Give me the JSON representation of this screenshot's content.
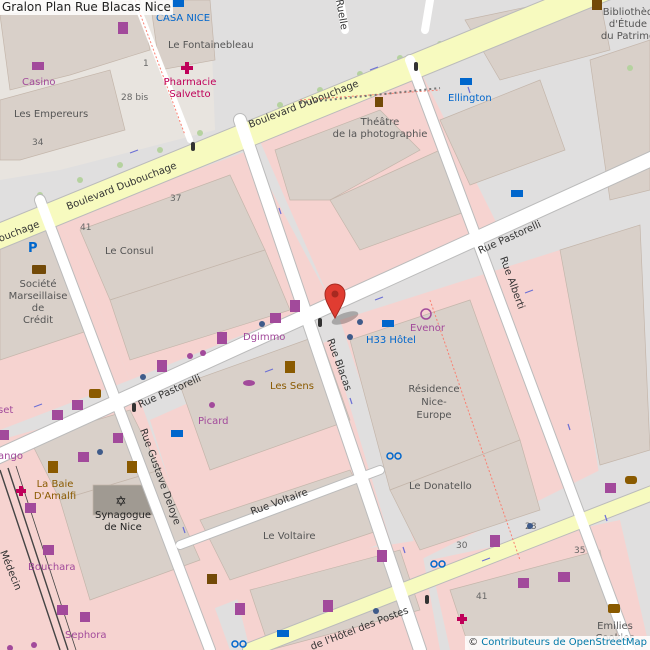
{
  "title": "Gralon Plan Rue Blacas Nice",
  "attribution": {
    "symbol": "©",
    "text": "Contributeurs de OpenStreetMap"
  },
  "colors": {
    "land": "#f2efe9",
    "residential": "#e0dfdf",
    "pedestrian": "#f6d3d0",
    "building": "#d9d0c9",
    "building_edge": "#c4b6ab",
    "primary_road": "#fcd6a4",
    "secondary_road": "#f7fabf",
    "residential_road": "#ffffff",
    "street_label": "#333333",
    "poi_label": "#a24a9b",
    "address_label": "#666666",
    "marker": "#e03c31",
    "tram": "#444444"
  },
  "streets": [
    {
      "id": "boulevard-dubouchage-upper",
      "text": "Boulevard Dubouchage"
    },
    {
      "id": "boulevard-dubouchage-lower",
      "text": "Boulevard Dubouchage"
    },
    {
      "id": "boulevard-dubouchage-edge",
      "text": "ouchage"
    },
    {
      "id": "rue-pastorelli-east",
      "text": "Rue Pastorelli"
    },
    {
      "id": "rue-pastorelli-west",
      "text": "Rue Pastorelli"
    },
    {
      "id": "rue-alberti",
      "text": "Rue Alberti"
    },
    {
      "id": "rue-blacas",
      "text": "Rue Blacas"
    },
    {
      "id": "rue-gustave-deloye",
      "text": "Rue Gustave Deloye"
    },
    {
      "id": "rue-voltaire",
      "text": "Rue Voltaire"
    },
    {
      "id": "rue-hotel-des-postes",
      "text": "de l'Hôtel des Postes"
    },
    {
      "id": "ruelle",
      "text": "Ruelle"
    },
    {
      "id": "rue-assalit-fragment",
      "text": "Médecin"
    }
  ],
  "places": [
    {
      "id": "le-fontainebleau",
      "text": "Le Fontainebleau",
      "kind": "building"
    },
    {
      "id": "les-empereurs",
      "text": "Les Empereurs",
      "kind": "building"
    },
    {
      "id": "le-consul",
      "text": "Le Consul",
      "kind": "building"
    },
    {
      "id": "le-voltaire",
      "text": "Le Voltaire",
      "kind": "building"
    },
    {
      "id": "le-donatello",
      "text": "Le Donatello",
      "kind": "building"
    },
    {
      "id": "residence-nice-europe",
      "text": "Résidence\nNice-\nEurope",
      "kind": "building"
    },
    {
      "id": "theatre",
      "text": "Théâtre\nde la photographie",
      "kind": "poi"
    },
    {
      "id": "casa-nice",
      "text": "CASA NICE",
      "kind": "hotel"
    },
    {
      "id": "ellington",
      "text": "Ellington",
      "kind": "hotel"
    },
    {
      "id": "h33-hotel",
      "text": "H33 Hôtel",
      "kind": "hotel"
    },
    {
      "id": "pharmacie",
      "text": "Pharmacie\nSalvetto",
      "kind": "pharmacy"
    },
    {
      "id": "casino",
      "text": "Casino",
      "kind": "shop"
    },
    {
      "id": "societe-marseillaise",
      "text": "Société\nMarseillaise\nde\nCrédit",
      "kind": "bank"
    },
    {
      "id": "dgimmo",
      "text": "Dgimmo",
      "kind": "shop"
    },
    {
      "id": "les-sens",
      "text": "Les Sens",
      "kind": "restaurant"
    },
    {
      "id": "evenor",
      "text": "Evenor",
      "kind": "shop"
    },
    {
      "id": "picard",
      "text": "Picard",
      "kind": "shop"
    },
    {
      "id": "la-baie-damalfi",
      "text": "La Baie\nD'Amalfi",
      "kind": "restaurant"
    },
    {
      "id": "synagogue",
      "text": "Synagogue\nde Nice",
      "kind": "worship"
    },
    {
      "id": "bouchara",
      "text": "Bouchara",
      "kind": "shop"
    },
    {
      "id": "sephora",
      "text": "Sephora",
      "kind": "shop"
    },
    {
      "id": "emilies-cookies",
      "text": "Emilies\nCookies",
      "kind": "cafe"
    },
    {
      "id": "bibliotheque",
      "text": "Bibliothèq\nd'Étude\ndu Patrimo",
      "kind": "library"
    },
    {
      "id": "left-cut-1",
      "text": "set",
      "kind": "shop"
    },
    {
      "id": "left-cut-2",
      "text": "ango",
      "kind": "shop"
    }
  ],
  "addresses": [
    {
      "id": "a1",
      "text": "1"
    },
    {
      "id": "a28bis",
      "text": "28 bis"
    },
    {
      "id": "a34",
      "text": "34"
    },
    {
      "id": "a37",
      "text": "37"
    },
    {
      "id": "a41",
      "text": "41"
    },
    {
      "id": "a28",
      "text": "28"
    },
    {
      "id": "a30",
      "text": "30"
    },
    {
      "id": "a35",
      "text": "35"
    },
    {
      "id": "a41b",
      "text": "41"
    }
  ],
  "marker": {
    "label": "Rue Blacas Nice",
    "icon": "map-pin-icon"
  }
}
